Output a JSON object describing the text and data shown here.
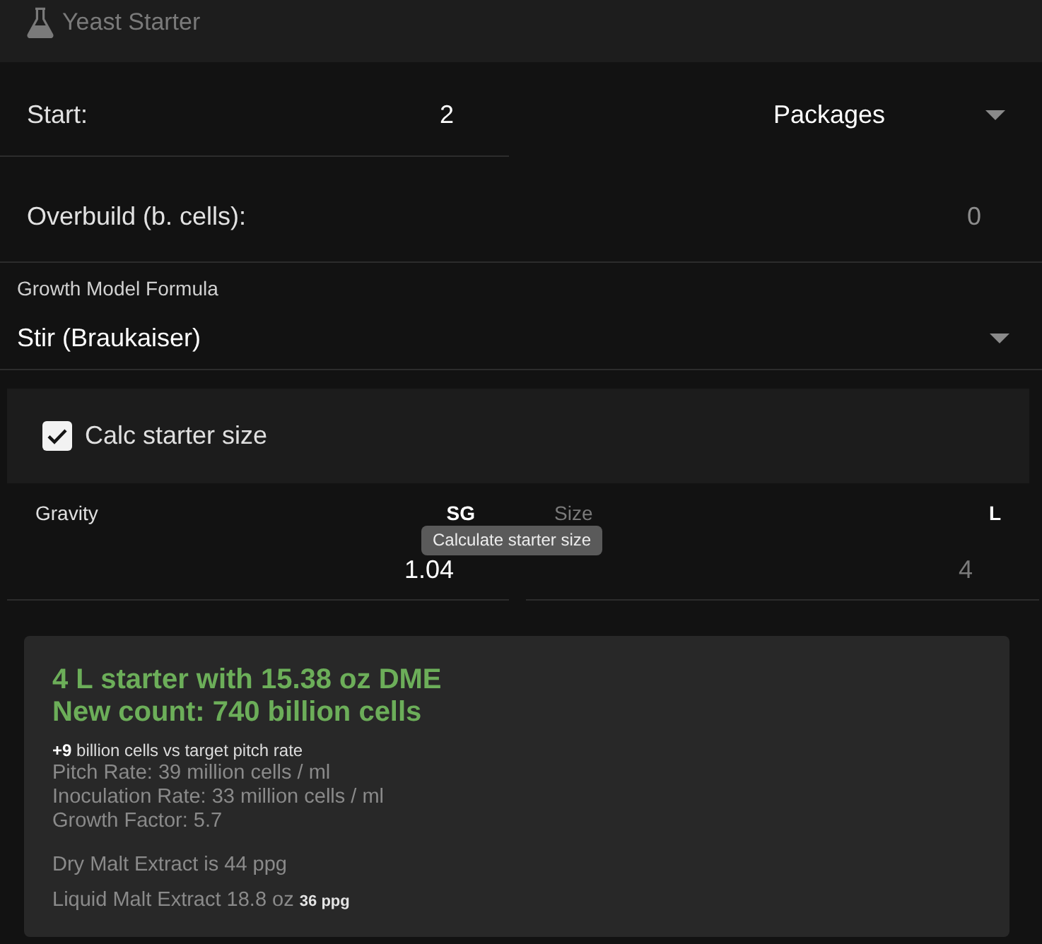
{
  "header": {
    "title": "Yeast Starter"
  },
  "start": {
    "label": "Start:",
    "value": "2",
    "unit_select": {
      "value": "Packages"
    }
  },
  "overbuild": {
    "label": "Overbuild (b. cells):",
    "placeholder": "0"
  },
  "growth_model": {
    "label": "Growth Model Formula",
    "value": "Stir (Braukaiser)"
  },
  "calc_starter_size": {
    "label": "Calc starter size",
    "checked": true
  },
  "starter_fields": [
    {
      "label": "Gravity",
      "unit": "SG",
      "value": "1.04",
      "disabled": false
    },
    {
      "label": "Size",
      "unit": "L",
      "value": "4",
      "disabled": true
    }
  ],
  "tooltip": {
    "text": "Calculate starter size"
  },
  "result": {
    "headline": [
      "4 L starter with 15.38 oz DME",
      "New count: 740 billion cells"
    ],
    "delta": "**+9** billion cells vs target pitch rate",
    "stats": [
      "Pitch Rate: 39 million cells / ml",
      "Inoculation Rate: 33 million cells / ml",
      "Growth Factor: 5.7"
    ],
    "extracts": [
      "Dry Malt Extract is 44 ppg",
      "Liquid Malt Extract 18.8 oz **36 ppg**"
    ]
  }
}
